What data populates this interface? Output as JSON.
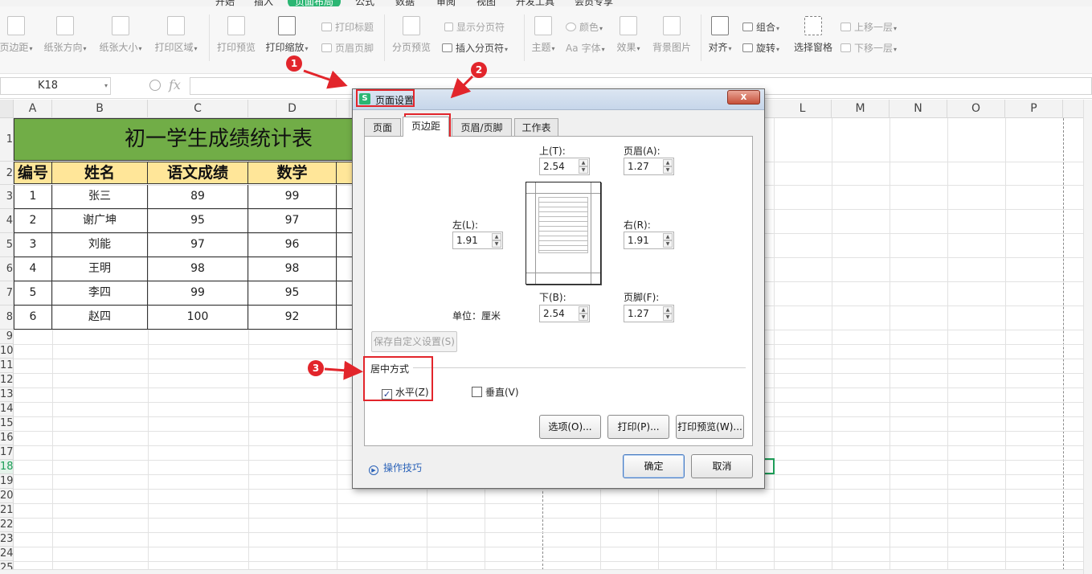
{
  "menu_tabs": [
    {
      "label": "开始",
      "active": false
    },
    {
      "label": "插入",
      "active": false
    },
    {
      "label": "页面布局",
      "active": true
    },
    {
      "label": "公式",
      "active": false
    },
    {
      "label": "数据",
      "active": false
    },
    {
      "label": "审阅",
      "active": false
    },
    {
      "label": "视图",
      "active": false
    },
    {
      "label": "开发工具",
      "active": false
    },
    {
      "label": "会员专享",
      "active": false
    }
  ],
  "ribbon": {
    "margins": "页边距",
    "orientation": "纸张方向",
    "size": "纸张大小",
    "print_area": "打印区域",
    "print_preview": "打印预览",
    "print_scale": "打印缩放",
    "print_titles": "打印标题",
    "header_footer": "页眉页脚",
    "page_break_preview": "分页预览",
    "show_page_breaks": "显示分页符",
    "insert_page_break": "插入分页符",
    "theme": "主题",
    "colors": "颜色",
    "fonts": "字体",
    "effects": "效果",
    "background": "背景图片",
    "align": "对齐",
    "group": "组合",
    "rotate": "旋转",
    "selection_pane": "选择窗格",
    "bring_forward": "上移一层",
    "send_backward": "下移一层"
  },
  "formula_bar": {
    "name_box": "K18",
    "fx": "fx",
    "content": ""
  },
  "columns": [
    "A",
    "B",
    "C",
    "D",
    "L",
    "M",
    "N",
    "O",
    "P"
  ],
  "row_numbers": [
    "1",
    "2",
    "3",
    "4",
    "5",
    "6",
    "7",
    "8",
    "9",
    "10",
    "11",
    "12",
    "13",
    "14",
    "15",
    "16",
    "17",
    "18",
    "19",
    "20",
    "21",
    "22",
    "23",
    "24",
    "25"
  ],
  "sheet": {
    "title": "初一学生成绩统计表",
    "headers": [
      "编号",
      "姓名",
      "语文成绩",
      "数学"
    ],
    "rows": [
      [
        "1",
        "张三",
        "89",
        "99"
      ],
      [
        "2",
        "谢广坤",
        "95",
        "97"
      ],
      [
        "3",
        "刘能",
        "97",
        "96"
      ],
      [
        "4",
        "王明",
        "98",
        "98"
      ],
      [
        "5",
        "李四",
        "99",
        "95"
      ],
      [
        "6",
        "赵四",
        "100",
        "92"
      ]
    ]
  },
  "dialog": {
    "title": "页面设置",
    "close": "x",
    "tabs": [
      "页面",
      "页边距",
      "页眉/页脚",
      "工作表"
    ],
    "active_tab": "页边距",
    "top_label": "上(T):",
    "top_value": "2.54",
    "header_label": "页眉(A):",
    "header_value": "1.27",
    "left_label": "左(L):",
    "left_value": "1.91",
    "right_label": "右(R):",
    "right_value": "1.91",
    "bottom_label": "下(B):",
    "bottom_value": "2.54",
    "footer_label": "页脚(F):",
    "footer_value": "1.27",
    "unit_label": "单位：厘米",
    "save_custom": "保存自定义设置(S)",
    "center_group": "居中方式",
    "horizontal": "水平(Z)",
    "horizontal_checked": true,
    "vertical": "垂直(V)",
    "vertical_checked": false,
    "options_btn": "选项(O)...",
    "print_btn": "打印(P)...",
    "print_preview_btn": "打印预览(W)...",
    "tips": "操作技巧",
    "ok": "确定",
    "cancel": "取消"
  },
  "annotations": {
    "badge1": "1",
    "badge2": "2",
    "badge3": "3"
  },
  "colors": {
    "accent_green": "#2bb673",
    "title_fill": "#71ad47",
    "header_fill": "#ffe699",
    "annotation_red": "#e2252b"
  }
}
